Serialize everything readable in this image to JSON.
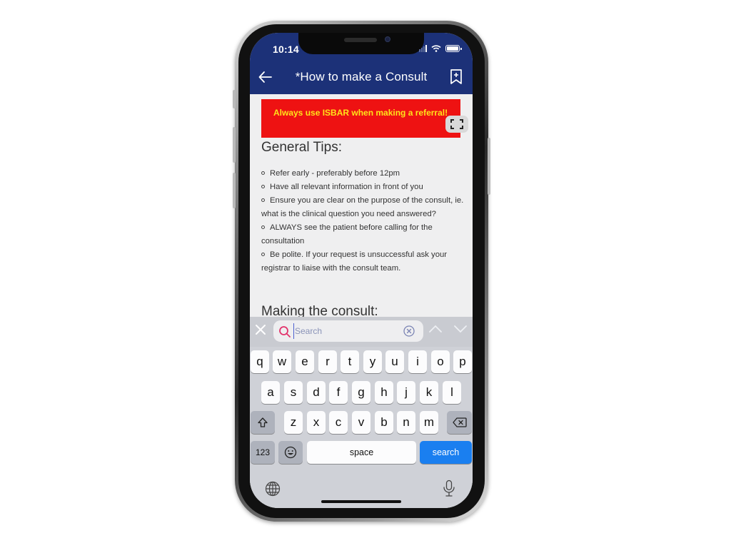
{
  "status_bar": {
    "time": "10:14",
    "battery_level": 1.0,
    "icons": [
      "signal-icon",
      "wifi-icon",
      "battery-icon"
    ]
  },
  "nav": {
    "back_icon": "arrow-left-icon",
    "title": "*How to make a Consult",
    "bookmark_icon": "bookmark-add-icon"
  },
  "colors": {
    "header_bg": "#1c3178",
    "alert_bg": "#ee1212",
    "alert_text": "#ffe31a",
    "search_key": "#1a7ff0"
  },
  "content": {
    "alert_text": "Always use ISBAR when making a referral!",
    "expand_icon": "fullscreen-icon",
    "general_heading": "General Tips:",
    "tips": [
      "Refer early - preferably before 12pm",
      "Have all relevant information in front of you",
      "Ensure you are clear on the purpose of the consult, ie. what is the clinical question you need answered?",
      "ALWAYS see the patient before calling for the consultation",
      "Be polite. If your request is unsuccessful ask your registrar to liaise with the consult team."
    ],
    "making_heading": "Making the consult:"
  },
  "find_bar": {
    "placeholder": "Search",
    "value": ""
  },
  "keyboard": {
    "row1": [
      "q",
      "w",
      "e",
      "r",
      "t",
      "y",
      "u",
      "i",
      "o",
      "p"
    ],
    "row2": [
      "a",
      "s",
      "d",
      "f",
      "g",
      "h",
      "j",
      "k",
      "l"
    ],
    "row3": [
      "z",
      "x",
      "c",
      "v",
      "b",
      "n",
      "m"
    ],
    "numbers_label": "123",
    "space_label": "space",
    "search_label": "search"
  }
}
